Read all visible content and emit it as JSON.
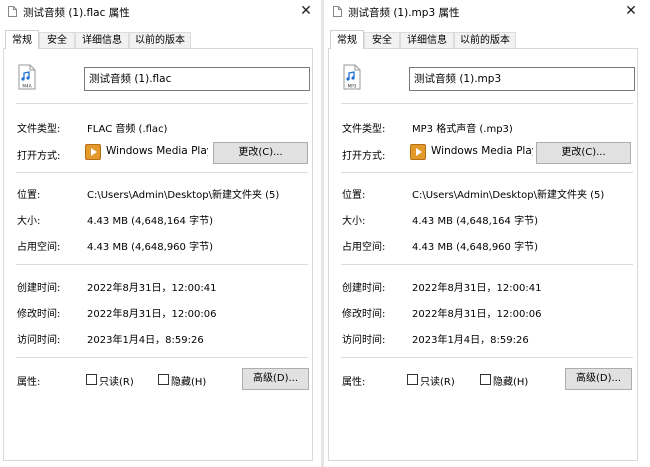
{
  "dialogs": [
    {
      "title": "测试音频 (1).flac 属性",
      "close_glyph": "✕",
      "tabs": [
        "常规",
        "安全",
        "详细信息",
        "以前的版本"
      ],
      "file_icon": "m4a-file-icon",
      "file_icon_label": "M4A",
      "file_name": "测试音频 (1).flac",
      "file_type_label": "文件类型:",
      "file_type": "FLAC 音频 (.flac)",
      "open_with_label": "打开方式:",
      "open_with_app": "Windows Media Playe",
      "change_button": "更改(C)...",
      "location_label": "位置:",
      "location": "C:\\Users\\Admin\\Desktop\\新建文件夹 (5)",
      "size_label": "大小:",
      "size": "4.43 MB (4,648,164 字节)",
      "size_on_disk_label": "占用空间:",
      "size_on_disk": "4.43 MB (4,648,960 字节)",
      "created_label": "创建时间:",
      "created": "2022年8月31日，12:00:41",
      "modified_label": "修改时间:",
      "modified": "2022年8月31日，12:00:06",
      "accessed_label": "访问时间:",
      "accessed": "2023年1月4日，8:59:26",
      "attributes_label": "属性:",
      "readonly_label": "只读(R)",
      "hidden_label": "隐藏(H)",
      "advanced_button": "高级(D)..."
    },
    {
      "title": "测试音频 (1).mp3 属性",
      "close_glyph": "✕",
      "tabs": [
        "常规",
        "安全",
        "详细信息",
        "以前的版本"
      ],
      "file_icon": "mp3-file-icon",
      "file_icon_label": "MP3",
      "file_name": "测试音频 (1).mp3",
      "file_type_label": "文件类型:",
      "file_type": "MP3 格式声音 (.mp3)",
      "open_with_label": "打开方式:",
      "open_with_app": "Windows Media Playe",
      "change_button": "更改(C)...",
      "location_label": "位置:",
      "location": "C:\\Users\\Admin\\Desktop\\新建文件夹 (5)",
      "size_label": "大小:",
      "size": "4.43 MB (4,648,164 字节)",
      "size_on_disk_label": "占用空间:",
      "size_on_disk": "4.43 MB (4,648,960 字节)",
      "created_label": "创建时间:",
      "created": "2022年8月31日，12:00:41",
      "modified_label": "修改时间:",
      "modified": "2022年8月31日，12:00:06",
      "accessed_label": "访问时间:",
      "accessed": "2023年1月4日，8:59:26",
      "attributes_label": "属性:",
      "readonly_label": "只读(R)",
      "hidden_label": "隐藏(H)",
      "advanced_button": "高级(D)..."
    }
  ],
  "colors": {
    "app_icon": "#e39a2b",
    "file_icon_accent": "#1f6fd0",
    "button_bg": "#e1e1e1"
  }
}
